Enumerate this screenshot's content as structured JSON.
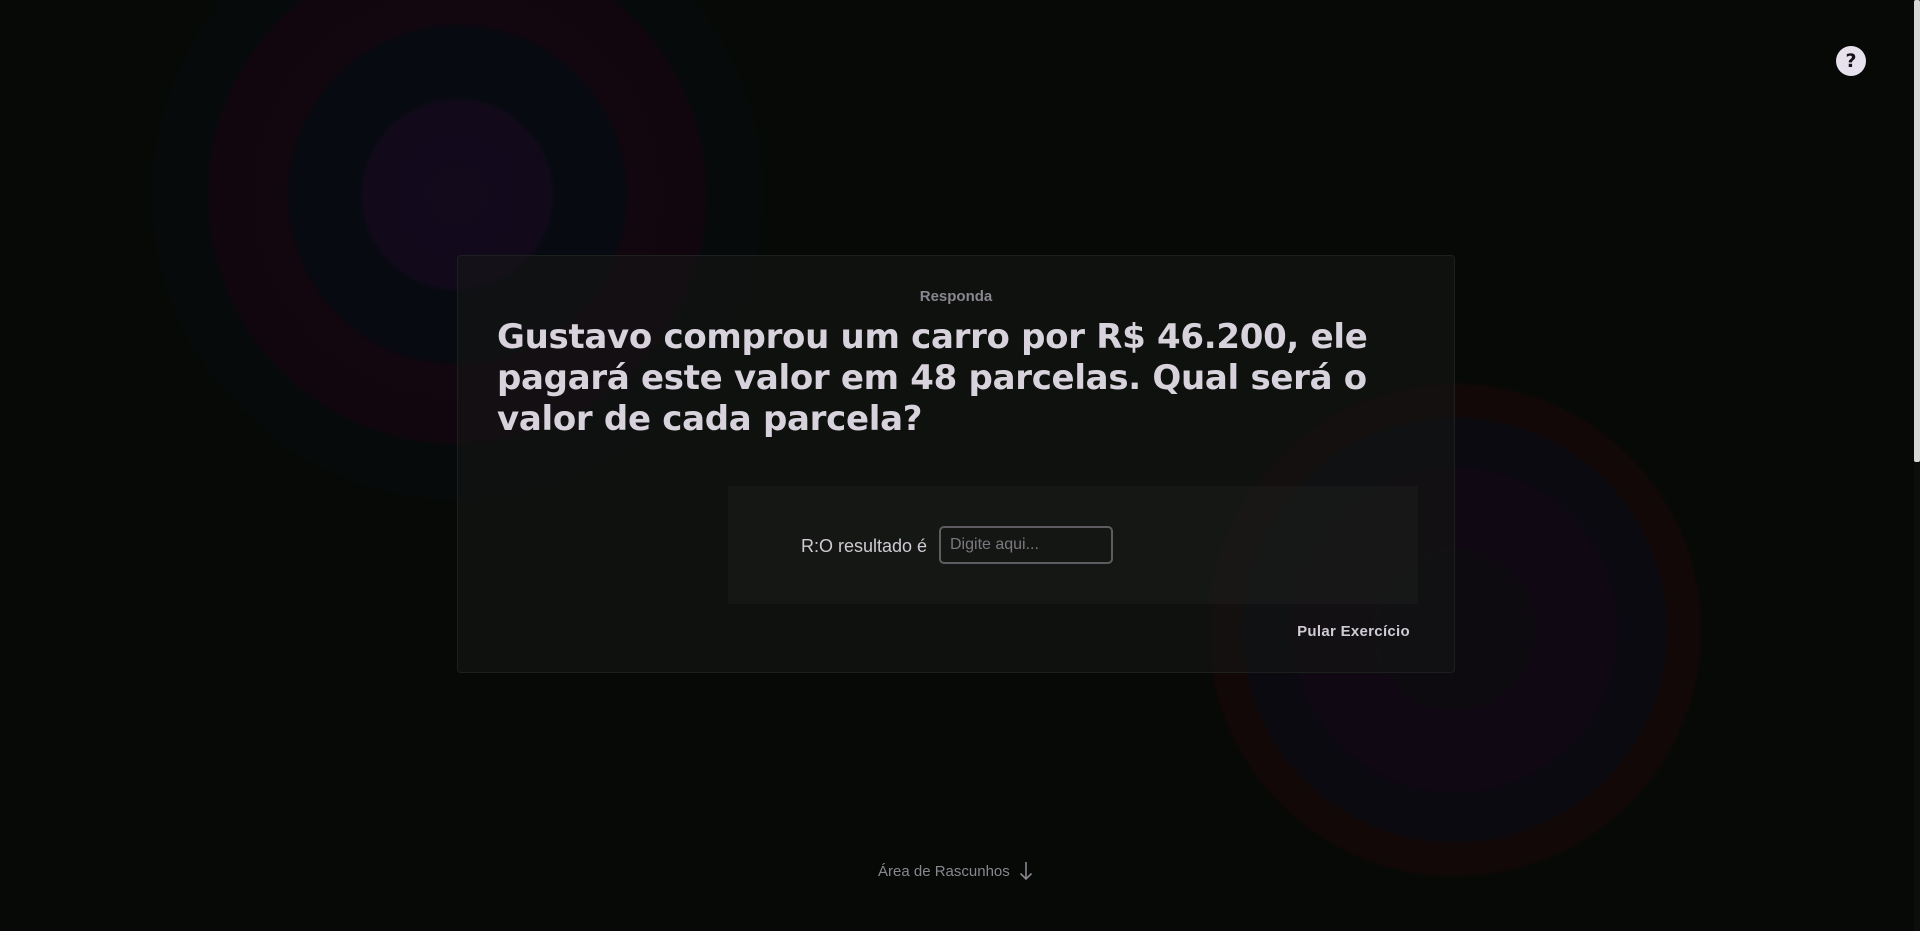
{
  "help": {
    "label": "?"
  },
  "exercise": {
    "label": "Responda",
    "question": "Gustavo comprou um carro por R$ 46.200, ele pagará este valor em 48 parcelas. Qual será o valor de cada parcela?",
    "answer_label": "R:O resultado é",
    "answer_placeholder": "Digite aqui...",
    "answer_value": "",
    "skip_label": "Pular Exercício"
  },
  "scratch": {
    "label": "Área de Rascunhos",
    "icon": "arrow-down-icon"
  }
}
